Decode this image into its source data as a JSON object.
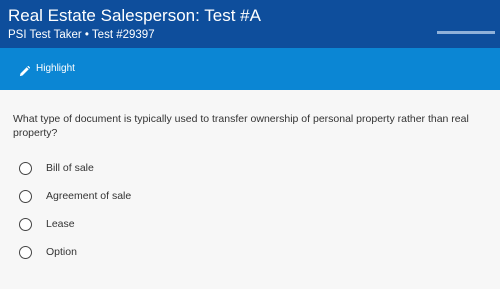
{
  "header": {
    "title": "Real Estate Salesperson: Test #A",
    "subtitle": "PSI Test Taker • Test #29397",
    "progress": 0.0
  },
  "toolbar": {
    "highlight_label": "Highlight",
    "highlight_icon": "pencil-icon"
  },
  "question": {
    "text": "What type of document is typically used to transfer ownership of personal property rather than real property?",
    "options": [
      {
        "label": "Bill of sale",
        "selected": false
      },
      {
        "label": "Agreement of sale",
        "selected": false
      },
      {
        "label": "Lease",
        "selected": false
      },
      {
        "label": "Option",
        "selected": false
      }
    ]
  },
  "colors": {
    "header_bg": "#0e4e9c",
    "toolbar_bg": "#0b86d4",
    "page_bg": "#f7f7f7"
  }
}
